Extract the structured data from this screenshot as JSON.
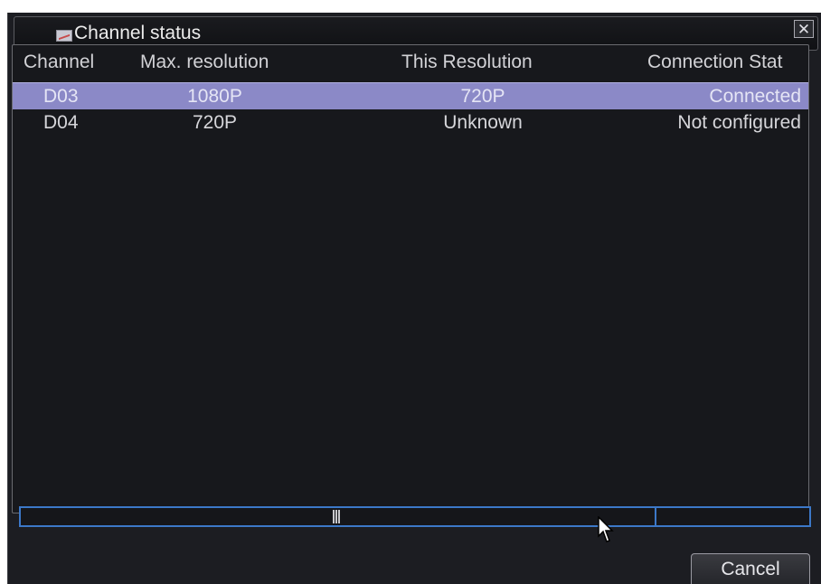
{
  "window": {
    "title": "Channel status",
    "title_icon": "chart-icon",
    "close_label": "✕"
  },
  "table": {
    "columns": [
      "Channel",
      "Max. resolution",
      "This Resolution",
      "Connection Stat"
    ],
    "rows": [
      {
        "channel": "D03",
        "max_resolution": "1080P",
        "this_resolution": "720P",
        "connection_status": "Connected",
        "selected": true
      },
      {
        "channel": "D04",
        "max_resolution": "720P",
        "this_resolution": "Unknown",
        "connection_status": "Not configured",
        "selected": false
      }
    ]
  },
  "footer": {
    "cancel_label": "Cancel"
  },
  "colors": {
    "background": "#1c1d22",
    "selection": "#8b89c7",
    "scrollbar_accent": "#3c78c8"
  }
}
